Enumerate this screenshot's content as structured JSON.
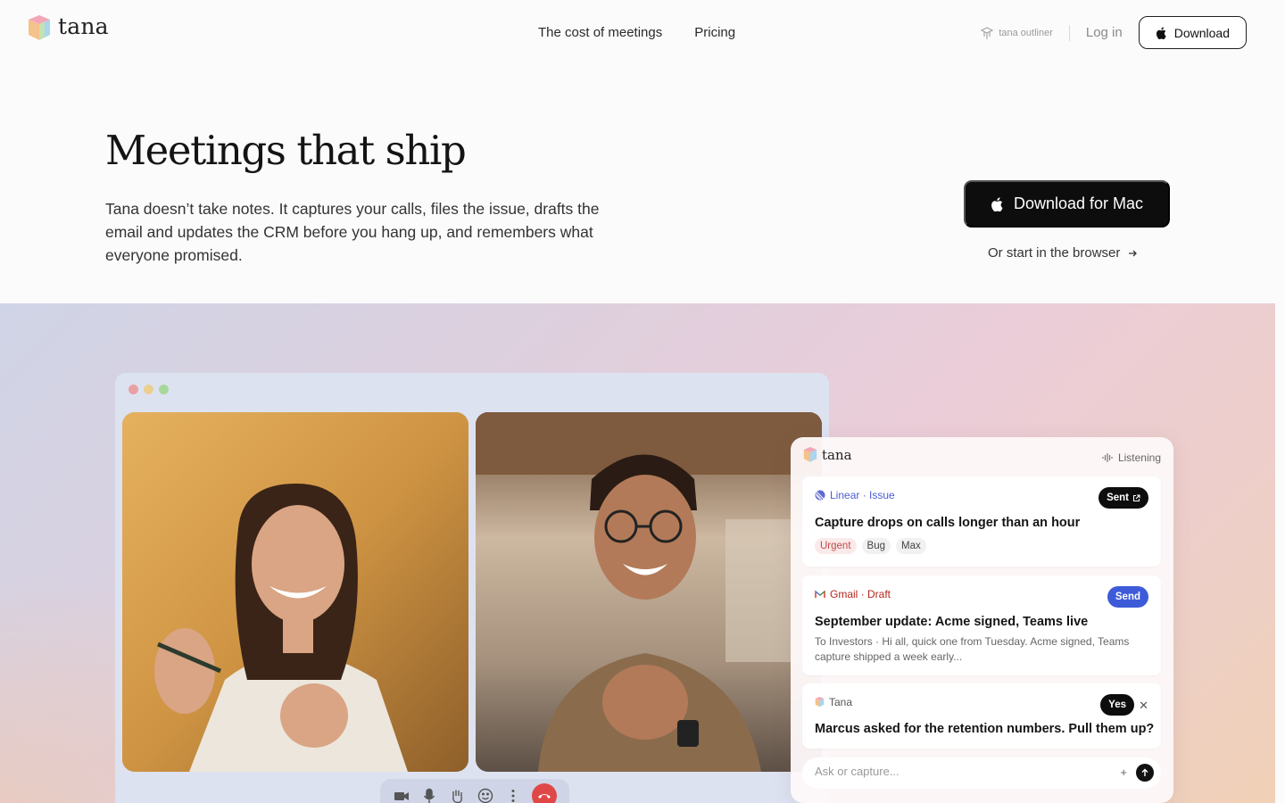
{
  "nav": {
    "logo_text": "tana",
    "links": [
      "The cost of meetings",
      "Pricing"
    ],
    "outliner_label": "tana outliner",
    "login_label": "Log in",
    "download_label": "Download"
  },
  "hero": {
    "title": "Meetings that ship",
    "subtitle": "Tana doesn’t take notes. It captures your calls, files the issue, drafts the email and updates the CRM before you hang up, and remembers what everyone promised.",
    "cta_primary": "Download for Mac",
    "cta_secondary": "Or start in the browser"
  },
  "panel": {
    "brand": "tana",
    "status": "Listening",
    "cards": [
      {
        "source": "Linear · Issue",
        "source_color": "#4b5bd6",
        "badge": "Sent",
        "badge_color": "#0d0d0d",
        "title": "Capture drops on calls longer than an hour",
        "tags": [
          "Urgent",
          "Bug",
          "Max"
        ]
      },
      {
        "source": "Gmail · Draft",
        "source_color": "#b3261e",
        "badge": "Send",
        "badge_color": "#3d5bd9",
        "title": "September update: Acme signed, Teams live",
        "body": "To Investors · Hi all, quick one from Tuesday. Acme signed, Teams capture shipped a week early..."
      },
      {
        "source": "Tana",
        "source_color": "#555555",
        "badge": "Yes",
        "badge_color": "#0d0d0d",
        "title": "Marcus asked for the retention numbers. Pull them up?"
      }
    ],
    "ask_placeholder": "Ask or capture..."
  },
  "call": {
    "controls": [
      "camera-icon",
      "microphone-icon",
      "raise-hand-icon",
      "emoji-icon",
      "more-icon",
      "end-call-icon"
    ]
  },
  "colors": {
    "accent_dark": "#0d0d0d",
    "urgent": "#c14a4a",
    "send_blue": "#3d5bd9"
  }
}
